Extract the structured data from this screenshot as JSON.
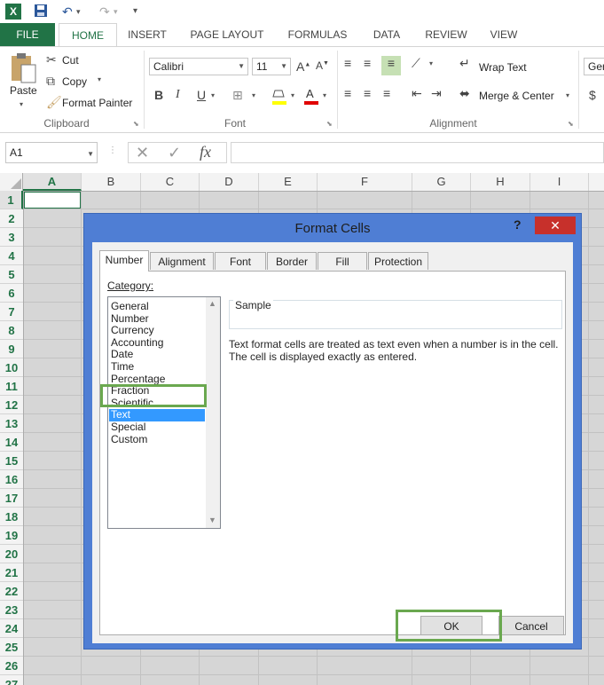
{
  "quick_access": {
    "undo": "↶",
    "redo": "↷",
    "customize": "▾"
  },
  "tabs": [
    "FILE",
    "HOME",
    "INSERT",
    "PAGE LAYOUT",
    "FORMULAS",
    "DATA",
    "REVIEW",
    "VIEW"
  ],
  "ribbon": {
    "clipboard": {
      "paste": "Paste",
      "cut": "Cut",
      "copy": "Copy",
      "format_painter": "Format Painter",
      "label": "Clipboard"
    },
    "font": {
      "name": "Calibri",
      "size": "11",
      "bold": "B",
      "italic": "I",
      "underline": "U",
      "label": "Font"
    },
    "alignment": {
      "wrap_text": "Wrap Text",
      "merge_center": "Merge & Center",
      "label": "Alignment"
    },
    "number": {
      "format": "Ger",
      "currency": "$"
    }
  },
  "formula_bar": {
    "name_box": "A1",
    "fx": "fx",
    "value": ""
  },
  "columns": [
    "A",
    "B",
    "C",
    "D",
    "E",
    "F",
    "G",
    "H",
    "I"
  ],
  "rows": [
    "1",
    "2",
    "3",
    "4",
    "5",
    "6",
    "7",
    "8",
    "9",
    "10",
    "11",
    "12",
    "13",
    "14",
    "15",
    "16",
    "17",
    "18",
    "19",
    "20",
    "21",
    "22",
    "23",
    "24",
    "25",
    "26",
    "27"
  ],
  "dialog": {
    "title": "Format Cells",
    "help": "?",
    "close": "✕",
    "tabs": [
      "Number",
      "Alignment",
      "Font",
      "Border",
      "Fill",
      "Protection"
    ],
    "category_label": "Category:",
    "categories": [
      "General",
      "Number",
      "Currency",
      "Accounting",
      "Date",
      "Time",
      "Percentage",
      "Fraction",
      "Scientific",
      "Text",
      "Special",
      "Custom"
    ],
    "selected_category": "Text",
    "sample_label": "Sample",
    "description_line1": "Text format cells are treated as text even when a number is in the cell.",
    "description_line2": "The cell is displayed exactly as entered.",
    "ok": "OK",
    "cancel": "Cancel"
  },
  "colors": {
    "excel_green": "#217346",
    "dialog_blue": "#4f7ed4",
    "highlight_green": "#6aa84f",
    "selection_blue": "#3399ff",
    "close_red": "#c7302b"
  }
}
